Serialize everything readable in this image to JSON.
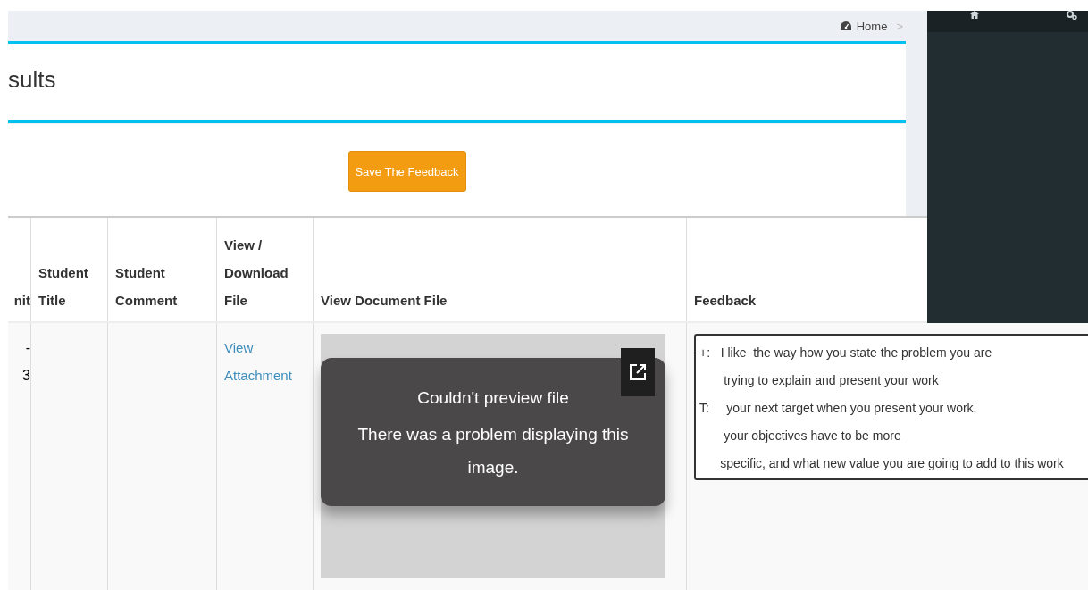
{
  "breadcrumb": {
    "items": [
      "Home"
    ],
    "separator": ">"
  },
  "page_title": "sults",
  "save_button": "Save The Feedback",
  "table": {
    "columns": [
      {
        "label": "nit"
      },
      {
        "label": "Student Title"
      },
      {
        "label": "Student Comment"
      },
      {
        "label": "View / Download File"
      },
      {
        "label": "View Document File"
      },
      {
        "label": "Feedback"
      }
    ],
    "rows": [
      {
        "column_1": [
          "-",
          "3"
        ],
        "student_title": "",
        "student_comment": "",
        "attachment_link": "View Attachment",
        "preview": {
          "title": "Couldn't preview file",
          "message": "There was a problem displaying this image."
        },
        "feedback": "+:   I like  the way how you state the problem you are\n       trying to explain and present your work\nT:     your next target when you present your work,\n       your objectives have to be more\n      specific, and what new value you are going to add to this work"
      }
    ]
  }
}
